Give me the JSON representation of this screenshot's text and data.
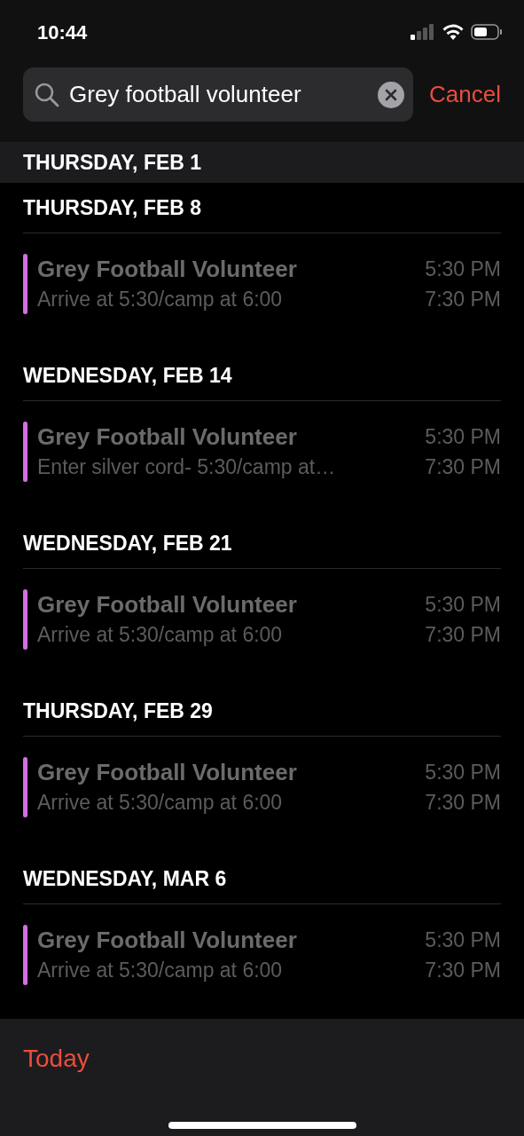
{
  "status_bar": {
    "time": "10:44"
  },
  "search": {
    "value": "Grey football volunteer",
    "cancel": "Cancel"
  },
  "sections": [
    {
      "date": "THURSDAY, FEB 1",
      "pinned": true
    },
    {
      "date": "THURSDAY, FEB 8",
      "pinned": false,
      "events": [
        {
          "title": "Grey Football Volunteer",
          "note": "Arrive at 5:30/camp at 6:00",
          "start": "5:30 PM",
          "end": "7:30 PM",
          "color": "#d46fe4",
          "past": true
        }
      ]
    },
    {
      "date": "WEDNESDAY, FEB 14",
      "pinned": false,
      "events": [
        {
          "title": "Grey Football Volunteer",
          "note": "Enter silver cord- 5:30/camp at…",
          "start": "5:30 PM",
          "end": "7:30 PM",
          "color": "#d46fe4",
          "past": true
        }
      ]
    },
    {
      "date": "WEDNESDAY, FEB 21",
      "pinned": false,
      "events": [
        {
          "title": "Grey Football Volunteer",
          "note": "Arrive at 5:30/camp at 6:00",
          "start": "5:30 PM",
          "end": "7:30 PM",
          "color": "#d46fe4",
          "past": true
        }
      ]
    },
    {
      "date": "THURSDAY, FEB 29",
      "pinned": false,
      "events": [
        {
          "title": "Grey Football Volunteer",
          "note": "Arrive at 5:30/camp at 6:00",
          "start": "5:30 PM",
          "end": "7:30 PM",
          "color": "#d46fe4",
          "past": true
        }
      ]
    },
    {
      "date": "WEDNESDAY, MAR 6",
      "pinned": false,
      "events": [
        {
          "title": "Grey Football Volunteer",
          "note": "Arrive at 5:30/camp at 6:00",
          "start": "5:30 PM",
          "end": "7:30 PM",
          "color": "#d46fe4",
          "past": true
        }
      ]
    }
  ],
  "footer": {
    "today": "Today"
  }
}
